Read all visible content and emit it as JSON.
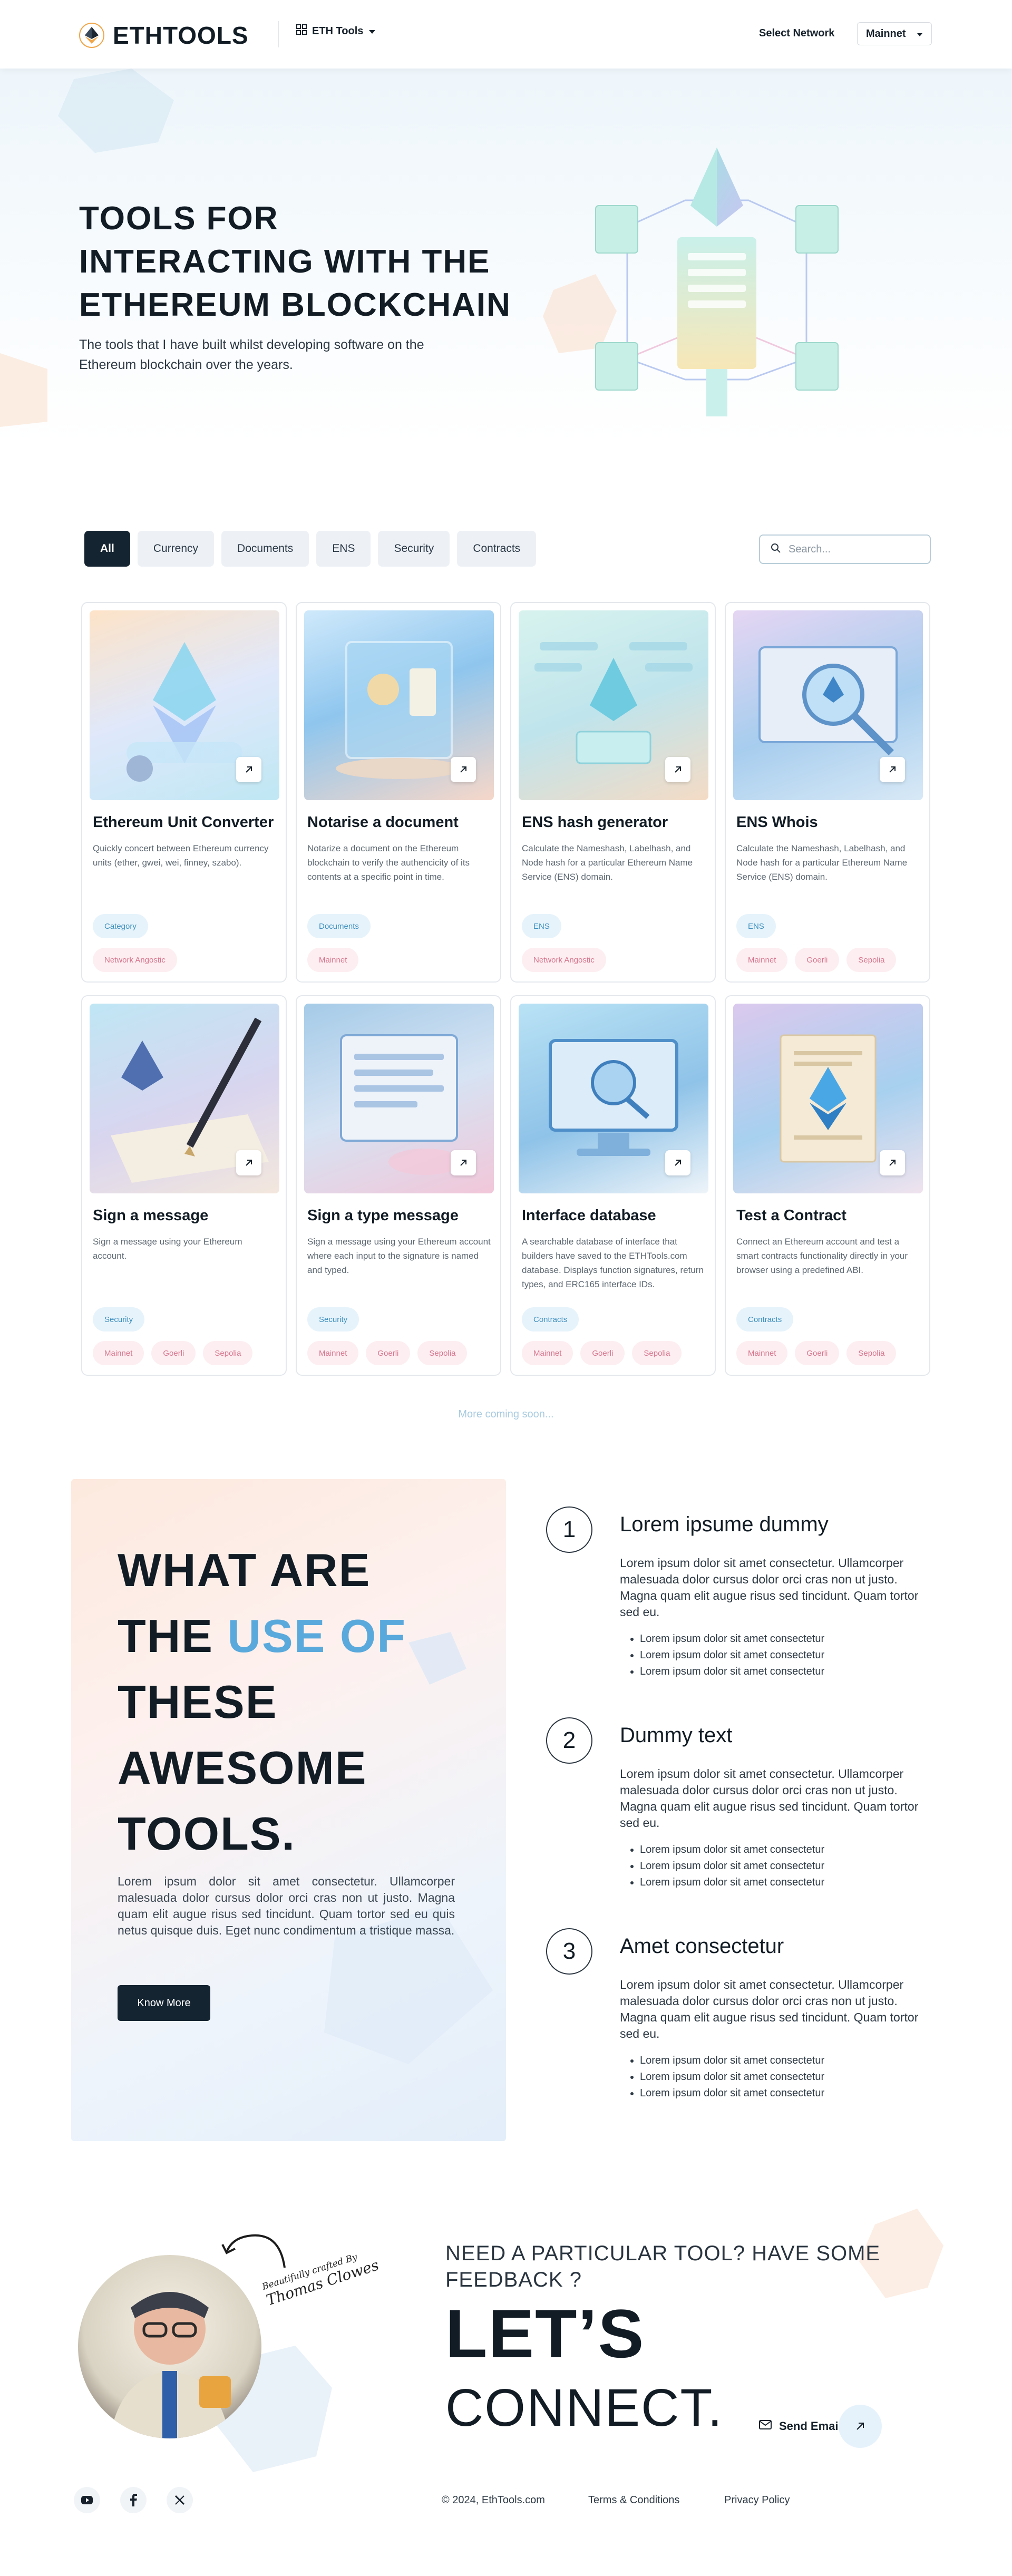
{
  "header": {
    "logo_text": "ETHTOOLS",
    "tools_menu_label": "ETH Tools",
    "select_network_label": "Select Network",
    "network_value": "Mainnet"
  },
  "hero": {
    "title": "TOOLS FOR INTERACTING WITH THE ETHEREUM BLOCKCHAIN",
    "subtitle": "The tools that I have built whilst developing software on the Ethereum blockchain over the years."
  },
  "filters": {
    "chips": [
      "All",
      "Currency",
      "Documents",
      "ENS",
      "Security",
      "Contracts"
    ],
    "active": "All",
    "search_placeholder": "Search..."
  },
  "cards": [
    {
      "title": "Ethereum Unit Converter",
      "desc": "Quickly concert between Ethereum currency units (ether, gwei, wei, finney, szabo).",
      "tags_blue": [
        "Category"
      ],
      "tags_pink": [
        "Network Angostic"
      ]
    },
    {
      "title": "Notarise a document",
      "desc": "Notarize a document on the Ethereum blockchain to verify the authencicity of its contents at a specific point in time.",
      "tags_blue": [
        "Documents"
      ],
      "tags_pink": [
        "Mainnet"
      ]
    },
    {
      "title": "ENS hash generator",
      "desc": "Calculate the Nameshash, Labelhash, and Node hash for a particular Ethereum Name Service (ENS) domain.",
      "tags_blue": [
        "ENS"
      ],
      "tags_pink": [
        "Network Angostic"
      ]
    },
    {
      "title": "ENS Whois",
      "desc": "Calculate the Nameshash, Labelhash, and Node hash for a particular Ethereum Name Service (ENS) domain.",
      "tags_blue": [
        "ENS"
      ],
      "tags_pink": [
        "Mainnet",
        "Goerli",
        "Sepolia"
      ]
    },
    {
      "title": "Sign a message",
      "desc": "Sign a message using your Ethereum account.",
      "tags_blue": [
        "Security"
      ],
      "tags_pink": [
        "Mainnet",
        "Goerli",
        "Sepolia"
      ]
    },
    {
      "title": "Sign a type message",
      "desc": "Sign a message using your Ethereum account where each input to the signature is named and typed.",
      "tags_blue": [
        "Security"
      ],
      "tags_pink": [
        "Mainnet",
        "Goerli",
        "Sepolia"
      ]
    },
    {
      "title": "Interface database",
      "desc": "A searchable database of interface that builders have saved to the ETHTools.com database. Displays function signatures, return types, and ERC165 interface IDs.",
      "tags_blue": [
        "Contracts"
      ],
      "tags_pink": [
        "Mainnet",
        "Goerli",
        "Sepolia"
      ]
    },
    {
      "title": "Test a Contract",
      "desc": "Connect an Ethereum account and test a smart contracts functionality directly in your browser using a predefined ABI.",
      "tags_blue": [
        "Contracts"
      ],
      "tags_pink": [
        "Mainnet",
        "Goerli",
        "Sepolia"
      ]
    }
  ],
  "more_coming": "More coming soon...",
  "info": {
    "heading_1": "WHAT ARE",
    "heading_2a": "THE ",
    "heading_2b": "USE OF",
    "heading_3": "THESE",
    "heading_4": "AWESOME",
    "heading_5": "TOOLS.",
    "paragraph": "Lorem ipsum dolor sit amet consectetur. Ullamcorper malesuada dolor cursus dolor orci cras non ut justo. Magna quam elit augue risus sed tincidunt. Quam tortor sed eu quis netus quisque duis. Eget nunc condimentum a tristique massa.",
    "button_label": "Know More"
  },
  "steps": [
    {
      "num": "1",
      "title": "Lorem ipsume dummy",
      "text": "Lorem ipsum dolor sit amet consectetur. Ullamcorper malesuada dolor cursus dolor orci cras non ut justo. Magna quam elit augue risus sed tincidunt. Quam tortor sed eu.",
      "items": [
        "Lorem ipsum dolor sit amet consectetur",
        "Lorem ipsum dolor sit amet consectetur",
        "Lorem ipsum dolor sit amet consectetur"
      ]
    },
    {
      "num": "2",
      "title": "Dummy text",
      "text": "Lorem ipsum dolor sit amet consectetur. Ullamcorper malesuada dolor cursus dolor orci cras non ut justo. Magna quam elit augue risus sed tincidunt. Quam tortor sed eu.",
      "items": [
        "Lorem ipsum dolor sit amet consectetur",
        "Lorem ipsum dolor sit amet consectetur",
        "Lorem ipsum dolor sit amet consectetur"
      ]
    },
    {
      "num": "3",
      "title": "Amet consectetur",
      "text": "Lorem ipsum dolor sit amet consectetur. Ullamcorper malesuada dolor cursus dolor orci cras non ut justo. Magna quam elit augue risus sed tincidunt. Quam tortor sed eu.",
      "items": [
        "Lorem ipsum dolor sit amet consectetur",
        "Lorem ipsum dolor sit amet consectetur",
        "Lorem ipsum dolor sit amet consectetur"
      ]
    }
  ],
  "connect": {
    "crafted_small": "Beautifully crafted By",
    "crafted_name": "Thomas Clowes",
    "pre_heading": "NEED A PARTICULAR TOOL? HAVE SOME FEEDBACK ?",
    "big_1": "LET’S",
    "big_2": "CONNECT.",
    "send_email_label": "Send Email"
  },
  "footer": {
    "copyright": "© 2024, EthTools.com",
    "terms": "Terms & Conditions",
    "privacy": "Privacy Policy",
    "social_icons": [
      "youtube-icon",
      "facebook-icon",
      "x-icon"
    ]
  },
  "colors": {
    "dark": "#152431",
    "accent_blue": "#5aa9dc",
    "tag_blue_bg": "#e6f3fb",
    "tag_pink_bg": "#fdeef1"
  }
}
